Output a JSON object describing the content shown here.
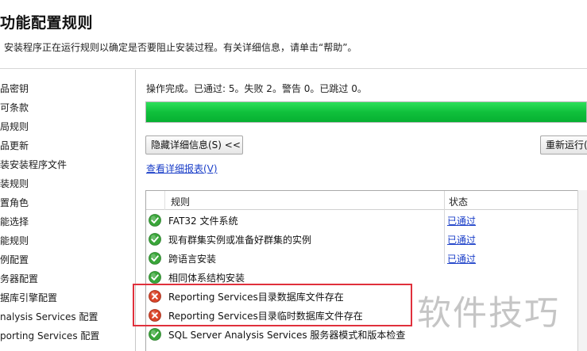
{
  "header": {
    "title": "功能配置规则",
    "subtitle": "安装程序正在运行规则以确定是否要阻止安装过程。有关详细信息，请单击“帮助”。"
  },
  "sidebar": {
    "items": [
      {
        "label": "品密钥"
      },
      {
        "label": "可条款"
      },
      {
        "label": "局规则"
      },
      {
        "label": "品更新"
      },
      {
        "label": "装安装程序文件"
      },
      {
        "label": "装规则"
      },
      {
        "label": "置角色"
      },
      {
        "label": "能选择"
      },
      {
        "label": "能规则"
      },
      {
        "label": "例配置"
      },
      {
        "label": "务器配置"
      },
      {
        "label": "据库引擎配置"
      },
      {
        "label": "nalysis Services 配置"
      },
      {
        "label": "porting Services 配置"
      }
    ]
  },
  "main": {
    "status_line": "操作完成。已通过: 5。失败 2。警告 0。已跳过 0。",
    "progress": 1.0,
    "details_button": "隐藏详细信息(S) <<",
    "rerun_button": "重新运行(R)",
    "report_link": "查看详细报表(V)"
  },
  "table": {
    "headers": {
      "rule": "规则",
      "status": "状态"
    },
    "rows": [
      {
        "name": "FAT32 文件系统",
        "status": "已通过",
        "result": "passed"
      },
      {
        "name": "现有群集实例或准备好群集的实例",
        "status": "已通过",
        "result": "passed"
      },
      {
        "name": "跨语言安装",
        "status": "已通过",
        "result": "passed"
      },
      {
        "name": "相同体系结构安装",
        "status": "",
        "result": "passed"
      },
      {
        "name": "Reporting Services目录数据库文件存在",
        "status": "",
        "result": "failed"
      },
      {
        "name": "Reporting Services目录临时数据库文件存在",
        "status": "",
        "result": "failed"
      },
      {
        "name": "SQL Server Analysis Services 服务器模式和版本检查",
        "status": "",
        "result": "passed"
      }
    ]
  },
  "icons": {
    "passed": "green-check-icon",
    "failed": "red-error-icon"
  },
  "colors": {
    "progress_green": "#10c03c",
    "link_blue": "#1a3ec8",
    "highlight_red": "#e0303c",
    "pass_green": "#3aa63a",
    "fail_red": "#d9452a"
  },
  "watermark": "软件技巧"
}
